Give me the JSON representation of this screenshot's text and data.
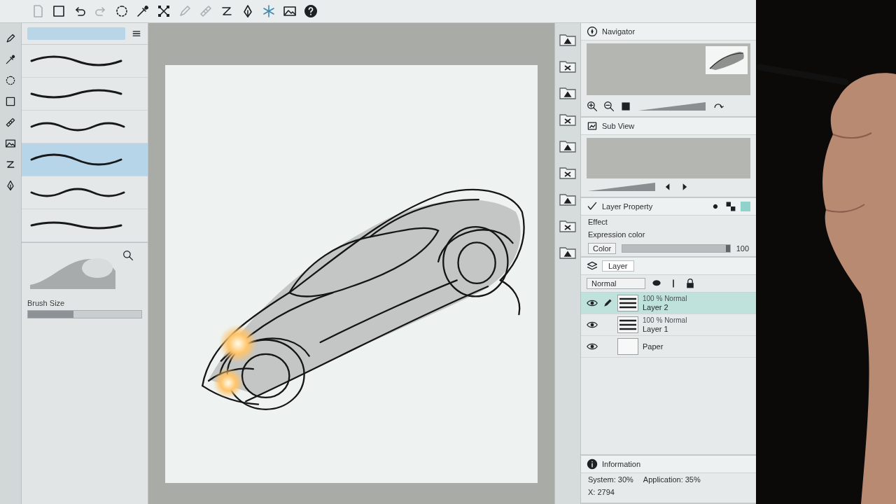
{
  "toolbar": {
    "buttons": [
      {
        "kind": "page",
        "disabled": true
      },
      {
        "kind": "frame",
        "disabled": false
      },
      {
        "kind": "undo",
        "disabled": false
      },
      {
        "kind": "redo",
        "disabled": true
      },
      {
        "kind": "lasso",
        "disabled": false
      },
      {
        "kind": "eyedropper",
        "disabled": false
      },
      {
        "kind": "transform",
        "disabled": false
      },
      {
        "kind": "pencil",
        "disabled": true
      },
      {
        "kind": "ruler",
        "disabled": true
      },
      {
        "kind": "zigzag",
        "disabled": false
      },
      {
        "kind": "pen",
        "disabled": false
      },
      {
        "kind": "snowflake",
        "disabled": false
      },
      {
        "kind": "image",
        "disabled": false
      },
      {
        "kind": "help",
        "disabled": false
      }
    ]
  },
  "sub_tools": {
    "items": [
      {
        "selected": false
      },
      {
        "selected": false
      },
      {
        "selected": false
      },
      {
        "selected": true
      },
      {
        "selected": false
      },
      {
        "selected": false
      }
    ]
  },
  "tool_property": {
    "brush_size": {
      "label": "Brush Size",
      "level": 0.4
    }
  },
  "navigator": {
    "title": "Navigator"
  },
  "sub_view": {
    "title": "Sub View"
  },
  "layer_property": {
    "title": "Layer Property",
    "effect": "Effect",
    "expression": "Expression color",
    "color_mode": "Color",
    "opacity": {
      "level": 1,
      "reading": "100"
    }
  },
  "layers": {
    "tab": "Layer",
    "blend_mode": "Normal",
    "items": [
      {
        "mode": "100 % Normal",
        "name": "Layer 2",
        "selected": true,
        "visible": true,
        "editing": true
      },
      {
        "mode": "100 % Normal",
        "name": "Layer 1",
        "selected": false,
        "visible": true,
        "editing": false
      },
      {
        "name": "Paper",
        "selected": false,
        "visible": true,
        "editing": false
      }
    ]
  },
  "information": {
    "title": "Information",
    "system": "System: 30%",
    "application": "Application: 35%",
    "x": "X: 2794"
  }
}
